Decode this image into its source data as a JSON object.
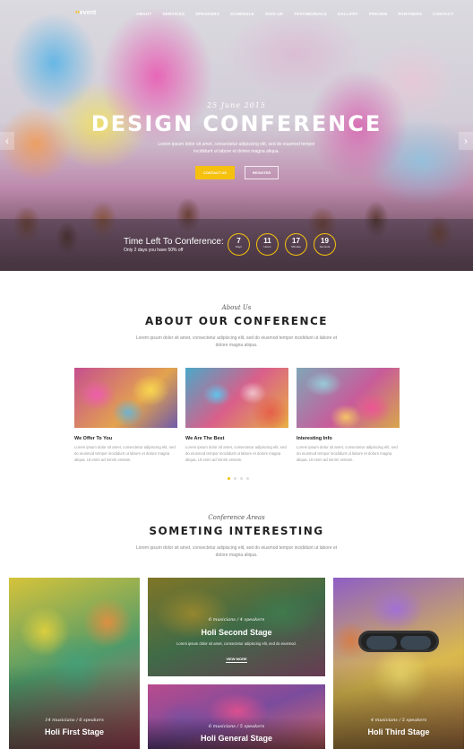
{
  "brand": {
    "mark": "••",
    "name": "event"
  },
  "nav": {
    "items": [
      "ABOUT",
      "SERVICES",
      "SPEAKERS",
      "SCHEDULE",
      "SIGN UP",
      "TESTIMONIALS",
      "GALLERY",
      "PRICING",
      "PARTNERS",
      "CONTACT"
    ]
  },
  "hero": {
    "date": "25 June 2015",
    "title": "DESIGN CONFERENCE",
    "desc": "Lorem ipsum dolor sit amet, consectetur adipiscing elit, sed do eiusmod tempor incididunt ut labore et dolore magna aliqua.",
    "btn_contact": "CONTACT US",
    "btn_register": "REGISTER",
    "arrow_left": "‹",
    "arrow_right": "›"
  },
  "countdown": {
    "title": "Time Left To Conference:",
    "subtitle": "Only 2 days you have 50% off",
    "units": [
      {
        "value": "7",
        "label": "Days"
      },
      {
        "value": "11",
        "label": "Hours"
      },
      {
        "value": "17",
        "label": "Minutes"
      },
      {
        "value": "19",
        "label": "Seconds"
      }
    ]
  },
  "about": {
    "script": "About Us",
    "title": "ABOUT OUR CONFERENCE",
    "desc": "Lorem ipsum dolor sit amet, consectetur adipiscing elit, sed do eiusmod tempor incididunt ut labore et dolore magna aliqua.",
    "cards": [
      {
        "title": "We Offer To You",
        "text": "Lorem ipsum dolor sit amet, consectetur adipiscing elit, sed do eiusmod tempor incididunt ut labore et dolore magna aliqua. Ut enim ad minim veniam."
      },
      {
        "title": "We Are The Best",
        "text": "Lorem ipsum dolor sit amet, consectetur adipiscing elit, sed do eiusmod tempor incididunt ut labore et dolore magna aliqua. Ut enim ad minim veniam."
      },
      {
        "title": "Interesting Info",
        "text": "Lorem ipsum dolor sit amet, consectetur adipiscing elit, sed do eiusmod tempor incididunt ut labore et dolore magna aliqua. Ut enim ad minim veniam."
      }
    ]
  },
  "areas": {
    "script": "Conference Areas",
    "title": "SOMETING INTERESTING",
    "desc": "Lorem ipsum dolor sit amet, consectetur adipiscing elit, sed do eiusmod tempor incididunt ut labore et dolore magna aliqua.",
    "stages": [
      {
        "meta": "14 musicians / 6 speakers",
        "name": "Holi First Stage"
      },
      {
        "meta": "6 musicians / 4 speakers",
        "name": "Holi Second Stage",
        "desc": "Lorem ipsum dolor sit amet, consectetur adipiscing elit, sed do eiusmod.",
        "more": "VIEW MORE"
      },
      {
        "meta": "6 musicians / 5 speakers",
        "name": "Holi General Stage"
      },
      {
        "meta": "4 musicians / 5 speakers",
        "name": "Holi Third Stage"
      }
    ]
  }
}
